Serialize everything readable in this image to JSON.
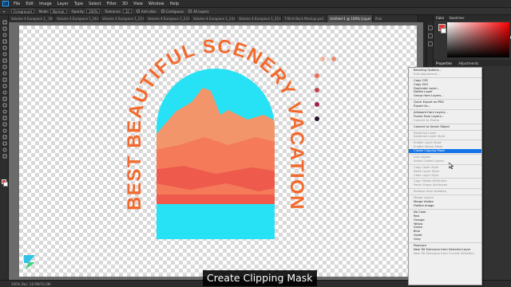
{
  "app": {
    "logo": "Ps"
  },
  "menubar": [
    "File",
    "Edit",
    "Image",
    "Layer",
    "Type",
    "Select",
    "Filter",
    "3D",
    "View",
    "Window",
    "Help"
  ],
  "options_bar": {
    "layer_select": "Foreground",
    "mode": "Normal",
    "opacity": "100%",
    "tolerance": "32",
    "anti_alias": "Anti-alias",
    "contiguous": "Contiguous",
    "all_layers": "All Layers"
  },
  "tabs": [
    {
      "label": "Volume 4 Europeun 1_ 30.tif",
      "active": false
    },
    {
      "label": "Volume 4 Europeun 1_26.tif",
      "active": false
    },
    {
      "label": "Volume 4 Europeun 1_22.tif",
      "active": false
    },
    {
      "label": "Volume 4 Europeun 1_23.tif",
      "active": false
    },
    {
      "label": "Volume 4 Europeun 1_24.tif",
      "active": false
    },
    {
      "label": "Volume 4 Europeun 1_25.tif",
      "active": false
    },
    {
      "label": "T-Shirt Back Mockup.psd",
      "active": false
    },
    {
      "label": "Untitled-1 @ 100% (Layer 1, RGB/8)",
      "active": true
    },
    {
      "label": "Polo",
      "active": false
    }
  ],
  "artwork": {
    "arc_text": "BEST BEAUTIFUL SCENERY VACATION",
    "colors": {
      "accent": "#f26a2e",
      "sky": "#27e2f5",
      "mountain_light": "#f2956b",
      "mountain_mid": "#f47a59",
      "mountain_dark": "#ee5a4c"
    }
  },
  "palette_dots": [
    "#f0a998",
    "#e8705a",
    "#c2424c",
    "#9e2547",
    "#23132b"
  ],
  "swatches_top": [
    "#f3b39f",
    "#ec8b70"
  ],
  "right_panel": {
    "tabs": [
      "Color",
      "Swatches"
    ],
    "props_tabs": [
      "Properties",
      "Adjustments"
    ]
  },
  "context_menu": [
    {
      "label": "Blending Options...",
      "disabled": false
    },
    {
      "label": "Edit Adjustment...",
      "disabled": true
    },
    {
      "sep": true
    },
    {
      "label": "Copy CSS",
      "disabled": false
    },
    {
      "label": "Copy SVG",
      "disabled": false
    },
    {
      "label": "Duplicate Layer...",
      "disabled": false
    },
    {
      "label": "Delete Layer",
      "disabled": false
    },
    {
      "label": "Group from Layers...",
      "disabled": false
    },
    {
      "sep": true
    },
    {
      "label": "Quick Export as PNG",
      "disabled": false
    },
    {
      "label": "Export As...",
      "disabled": false
    },
    {
      "sep": true
    },
    {
      "label": "Artboard from Layers...",
      "disabled": false
    },
    {
      "label": "Frame from Layers...",
      "disabled": false
    },
    {
      "label": "Convert to Frame",
      "disabled": true
    },
    {
      "sep": true
    },
    {
      "label": "Convert to Smart Object",
      "disabled": false
    },
    {
      "sep": true
    },
    {
      "label": "Rasterize Layer",
      "disabled": true
    },
    {
      "label": "Rasterize Layer Style",
      "disabled": true
    },
    {
      "sep": true
    },
    {
      "label": "Enable Layer Mask",
      "disabled": true
    },
    {
      "label": "Enable Vector Mask",
      "disabled": true
    },
    {
      "label": "Create Clipping Mask",
      "disabled": false,
      "highlight": true
    },
    {
      "sep": true
    },
    {
      "label": "Link Layers",
      "disabled": true
    },
    {
      "label": "Select Linked Layers",
      "disabled": true
    },
    {
      "sep": true
    },
    {
      "label": "Copy Layer Style",
      "disabled": true
    },
    {
      "label": "Paste Layer Style",
      "disabled": true
    },
    {
      "label": "Clear Layer Style",
      "disabled": true
    },
    {
      "sep": true
    },
    {
      "label": "Copy Shape Attributes",
      "disabled": true
    },
    {
      "label": "Paste Shape Attributes",
      "disabled": true
    },
    {
      "sep": true
    },
    {
      "label": "Release from Isolation",
      "disabled": true
    },
    {
      "sep": true
    },
    {
      "label": "Merge Layers",
      "disabled": true
    },
    {
      "label": "Merge Visible",
      "disabled": false
    },
    {
      "label": "Flatten Image",
      "disabled": false
    },
    {
      "sep": true
    },
    {
      "label": "No Color",
      "disabled": false
    },
    {
      "label": "Red",
      "disabled": false
    },
    {
      "label": "Orange",
      "disabled": false
    },
    {
      "label": "Yellow",
      "disabled": false
    },
    {
      "label": "Green",
      "disabled": false
    },
    {
      "label": "Blue",
      "disabled": false
    },
    {
      "label": "Violet",
      "disabled": false
    },
    {
      "label": "Gray",
      "disabled": false
    },
    {
      "sep": true
    },
    {
      "label": "Postcard",
      "disabled": false
    },
    {
      "label": "New 3D Extrusion from Selected Layer",
      "disabled": false
    },
    {
      "label": "New 3D Extrusion from Current Selection",
      "disabled": true
    }
  ],
  "status": "100%    Doc: 10.9M/15.0M",
  "caption": "Create Clipping Mask"
}
